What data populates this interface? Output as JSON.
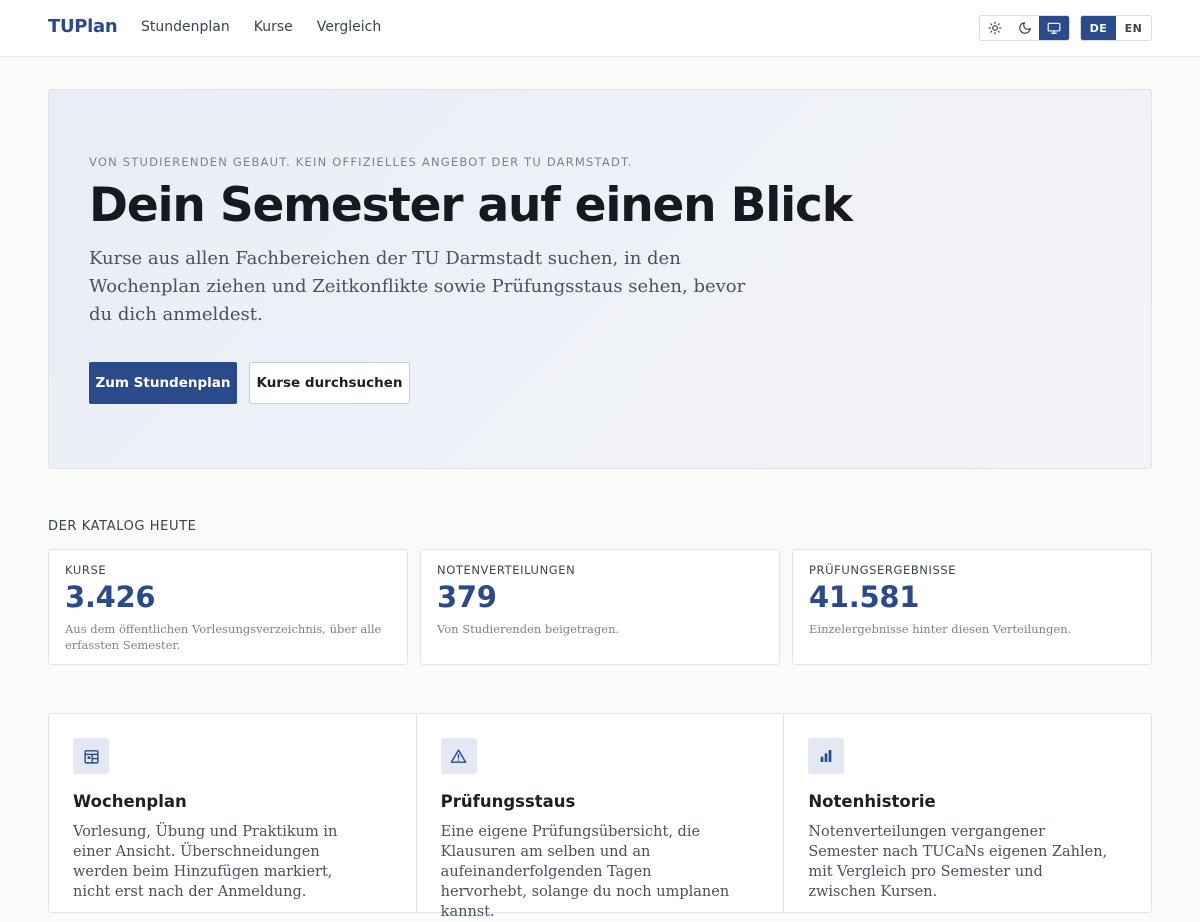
{
  "header": {
    "brand": "TUPlan",
    "nav": [
      "Stundenplan",
      "Kurse",
      "Vergleich"
    ],
    "theme_icons": [
      "sun-icon",
      "moon-icon",
      "monitor-icon"
    ],
    "theme_active": "monitor-icon",
    "languages": [
      "DE",
      "EN"
    ],
    "language_active": "DE"
  },
  "hero": {
    "eyebrow": "VON STUDIERENDEN GEBAUT. KEIN OFFIZIELLES ANGEBOT DER TU DARMSTADT.",
    "title": "Dein Semester auf einen Blick",
    "lead": "Kurse aus allen Fachbereichen der TU Darmstadt suchen, in den Wochenplan ziehen und Zeitkonflikte sowie Prüfungsstaus sehen, bevor du dich anmeldest.",
    "primary_button": "Zum Stundenplan",
    "secondary_button": "Kurse durchsuchen"
  },
  "catalog": {
    "heading": "DER KATALOG HEUTE",
    "stats": [
      {
        "label": "KURSE",
        "value": "3.426",
        "desc": "Aus dem öffentlichen Vorlesungsverzeichnis, über alle erfassten Semester."
      },
      {
        "label": "NOTENVERTEILUNGEN",
        "value": "379",
        "desc": "Von Studierenden beigetragen."
      },
      {
        "label": "PRÜFUNGSERGEBNISSE",
        "value": "41.581",
        "desc": "Einzelergebnisse hinter diesen Verteilungen."
      }
    ]
  },
  "features": [
    {
      "icon": "calendar-grid-icon",
      "title": "Wochenplan",
      "desc": "Vorlesung, Übung und Praktikum in einer Ansicht. Überschneidungen werden beim Hinzufügen markiert, nicht erst nach der Anmeldung."
    },
    {
      "icon": "warning-triangle-icon",
      "title": "Prüfungsstaus",
      "desc": "Eine eigene Prüfungsübersicht, die Klausuren am selben und an aufeinanderfolgenden Tagen hervorhebt, solange du noch umplanen kannst."
    },
    {
      "icon": "bar-chart-icon",
      "title": "Notenhistorie",
      "desc": "Notenverteilungen vergangener Semester nach TUCaNs eigenen Zahlen, mit Vergleich pro Semester und zwischen Kursen."
    }
  ],
  "colors": {
    "accent": "#2b4a8a",
    "background": "#fafaf9",
    "hero_tint": "#e8edf6"
  }
}
